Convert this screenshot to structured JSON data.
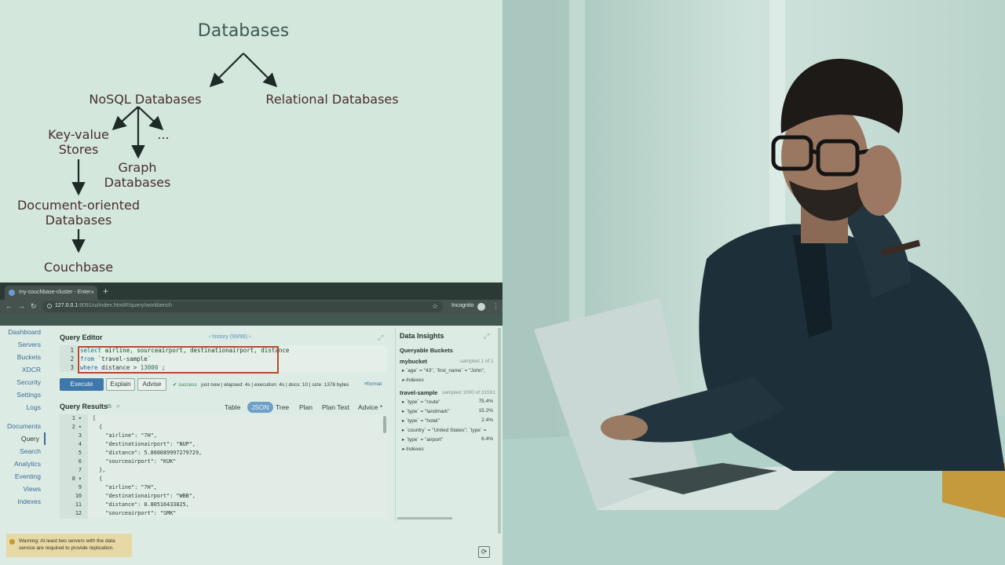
{
  "diagram": {
    "root": "Databases",
    "nosql": "NoSQL Databases",
    "relational": "Relational Databases",
    "keyvalue": "Key-value\nStores",
    "ellipsis": "...",
    "graph": "Graph\nDatabases",
    "document": "Document-oriented\nDatabases",
    "couchbase": "Couchbase"
  },
  "browser": {
    "tab_title": "my-couchbase-cluster - Enter",
    "tab_close": "×",
    "new_tab": "+",
    "url_host": "127.0.0.1",
    "url_path": ":8091/ui/index.html#!/query/workbench",
    "incognito": "Incognito"
  },
  "sidebar": {
    "items": [
      "Dashboard",
      "Servers",
      "Buckets",
      "XDCR",
      "Security",
      "Settings",
      "Logs"
    ],
    "items2": [
      "Documents",
      "Query",
      "Search",
      "Analytics",
      "Eventing",
      "Views",
      "Indexes"
    ],
    "active": "Query"
  },
  "query_editor": {
    "title": "Query Editor",
    "history": "history (99/99)",
    "line_numbers": [
      "1",
      "2",
      "3"
    ],
    "line1": "airline, sourceairport, destinationairport, distance",
    "line1_kw": "select",
    "line2_kw": "from",
    "line2": "`travel-sample`",
    "line3_kw": "where",
    "line3": "distance > ",
    "line3_num": "13000",
    "line3_end": " ;"
  },
  "buttons": {
    "execute": "Execute",
    "explain": "Explain",
    "advise": "Advise"
  },
  "status": {
    "result": "success",
    "time": "just now",
    "elapsed": "elapsed: 4s",
    "execution": "execution: 4s",
    "docs": "docs: 10",
    "size": "size: 1378 bytes",
    "format": "format"
  },
  "query_results": {
    "title": "Query Results",
    "views": [
      "Table",
      "JSON",
      "Tree",
      "Plan",
      "Plan Text",
      "Advice *"
    ],
    "active_view": "JSON",
    "rows": [
      {
        "n": "1 ▾",
        "t": "["
      },
      {
        "n": "2 ▾",
        "t": "  {"
      },
      {
        "n": "3",
        "t": "    \"airline\": \"7H\","
      },
      {
        "n": "4",
        "t": "    \"destinationairport\": \"NUP\","
      },
      {
        "n": "5",
        "t": "    \"distance\": 5.860089997279729,"
      },
      {
        "n": "6",
        "t": "    \"sourceairport\": \"KUK\""
      },
      {
        "n": "7",
        "t": "  },"
      },
      {
        "n": "8 ▾",
        "t": "  {"
      },
      {
        "n": "9",
        "t": "    \"airline\": \"7H\","
      },
      {
        "n": "10",
        "t": "    \"destinationairport\": \"WBB\","
      },
      {
        "n": "11",
        "t": "    \"distance\": 8.80516433825,"
      },
      {
        "n": "12",
        "t": "    \"sourceairport\": \"SMK\""
      }
    ]
  },
  "data_insights": {
    "title": "Data Insights",
    "queryable": "Queryable Buckets",
    "bucket1": "mybucket",
    "bucket1_sample": "sampled 1 of 1",
    "bucket1_row": "`age` = \"43\", `first_name` = \"John\",",
    "indexes": "Indexes",
    "bucket2": "travel-sample",
    "bucket2_sample": "sampled 1000 of 31591",
    "types": [
      {
        "label": "`type` = \"route\"",
        "pct": "75.4%"
      },
      {
        "label": "`type` = \"landmark\"",
        "pct": "15.2%"
      },
      {
        "label": "`type` = \"hotel\"",
        "pct": "2.4%"
      },
      {
        "label": "`country` = \"United States\", `type` =",
        "pct": ""
      },
      {
        "label": "`type` = \"airport\"",
        "pct": "6.4%"
      }
    ]
  },
  "warning": {
    "text": "Warning: At least two servers with the data service are required to provide replication."
  }
}
